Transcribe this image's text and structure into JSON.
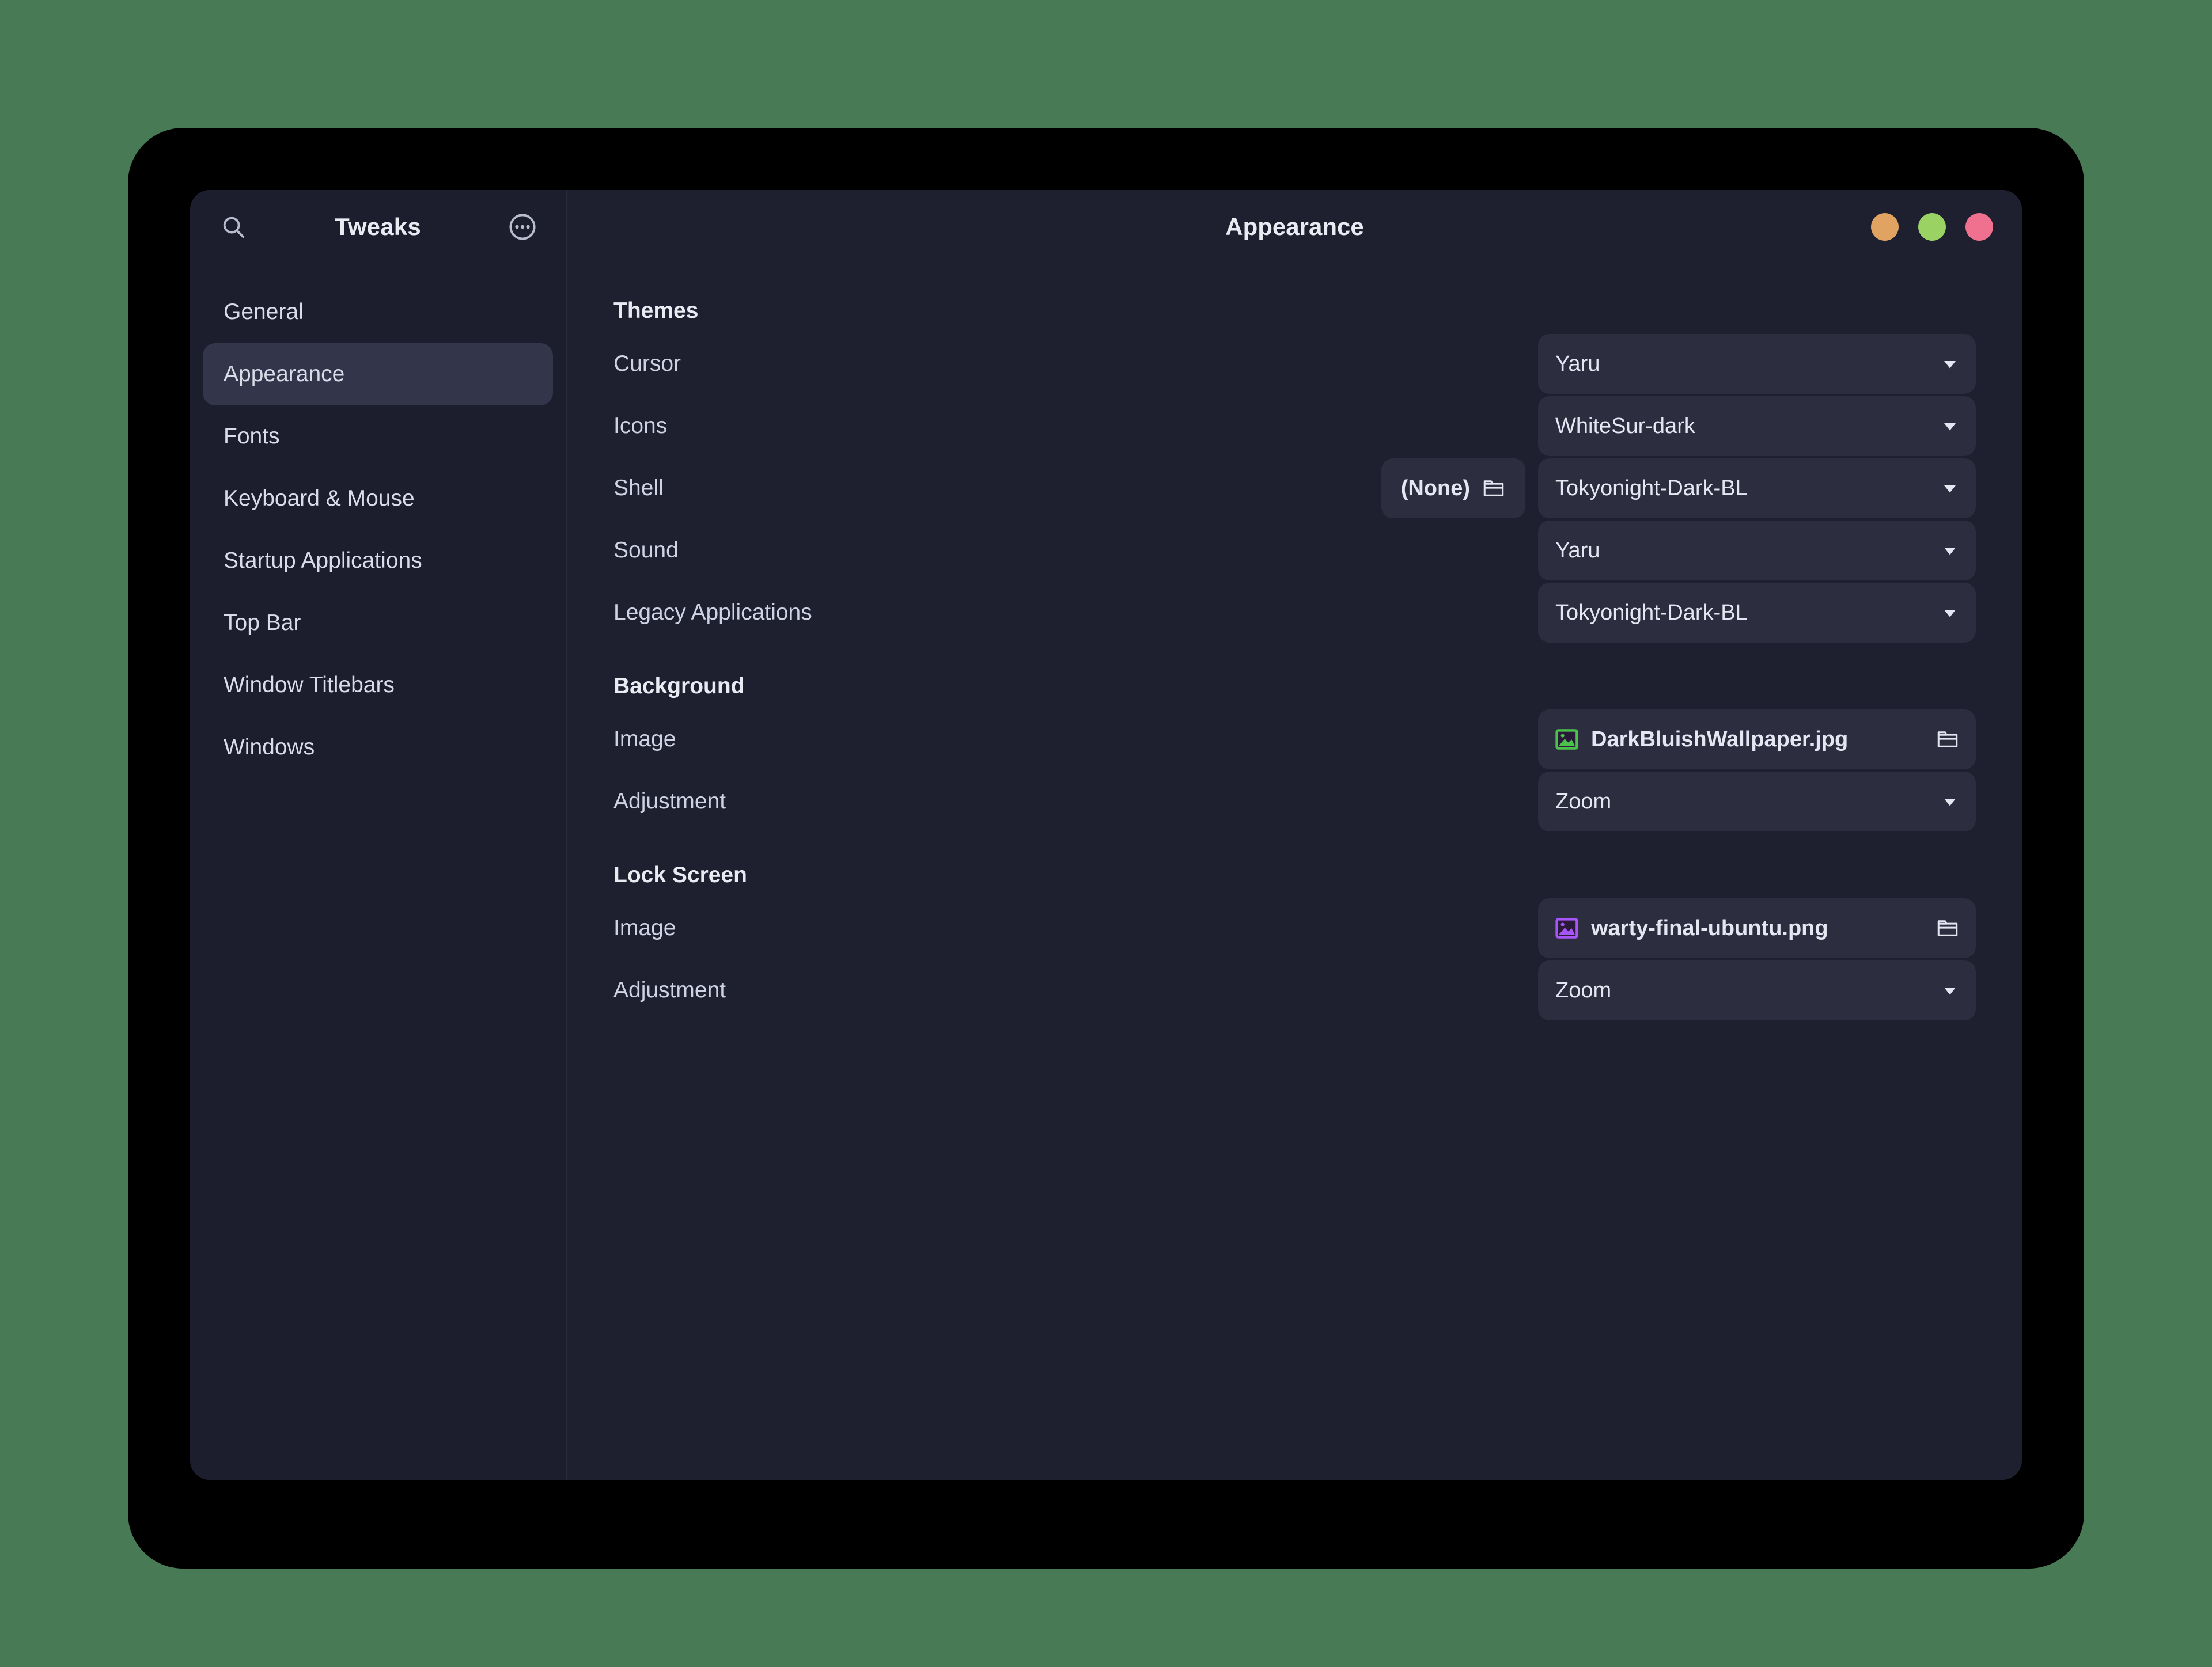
{
  "desktop": {
    "background_color": "#487a55"
  },
  "window": {
    "background_color": "#1e2030",
    "sidebar": {
      "title": "Tweaks",
      "search_icon": "search-icon",
      "menu_icon": "more-options-icon",
      "items": [
        {
          "label": "General",
          "selected": false
        },
        {
          "label": "Appearance",
          "selected": true
        },
        {
          "label": "Fonts",
          "selected": false
        },
        {
          "label": "Keyboard & Mouse",
          "selected": false
        },
        {
          "label": "Startup Applications",
          "selected": false
        },
        {
          "label": "Top Bar",
          "selected": false
        },
        {
          "label": "Window Titlebars",
          "selected": false
        },
        {
          "label": "Windows",
          "selected": false
        }
      ]
    },
    "header": {
      "title": "Appearance",
      "controls": [
        {
          "name": "minimize-button",
          "color": "#e0a362"
        },
        {
          "name": "maximize-button",
          "color": "#9bd264"
        },
        {
          "name": "close-button",
          "color": "#ef718f"
        }
      ]
    },
    "content": {
      "groups": [
        {
          "title": "Themes",
          "rows": [
            {
              "label": "Cursor",
              "control": "combo",
              "value": "Yaru"
            },
            {
              "label": "Icons",
              "control": "combo",
              "value": "WhiteSur-dark"
            },
            {
              "label": "Shell",
              "control": "combo",
              "value": "Tokyonight-Dark-BL",
              "extra_button": {
                "label": "(None)",
                "icon": "folder-icon"
              }
            },
            {
              "label": "Sound",
              "control": "combo",
              "value": "Yaru"
            },
            {
              "label": "Legacy Applications",
              "control": "combo",
              "value": "Tokyonight-Dark-BL"
            }
          ]
        },
        {
          "title": "Background",
          "rows": [
            {
              "label": "Image",
              "control": "file",
              "value": "DarkBluishWallpaper.jpg",
              "thumb_icon": "image-file-icon",
              "thumb_color": "#4bc24b",
              "chooser_icon": "folder-icon"
            },
            {
              "label": "Adjustment",
              "control": "combo",
              "value": "Zoom"
            }
          ]
        },
        {
          "title": "Lock Screen",
          "rows": [
            {
              "label": "Image",
              "control": "file",
              "value": "warty-final-ubuntu.png",
              "thumb_icon": "image-file-icon",
              "thumb_color": "#a855f7",
              "chooser_icon": "folder-icon"
            },
            {
              "label": "Adjustment",
              "control": "combo",
              "value": "Zoom"
            }
          ]
        }
      ]
    }
  }
}
